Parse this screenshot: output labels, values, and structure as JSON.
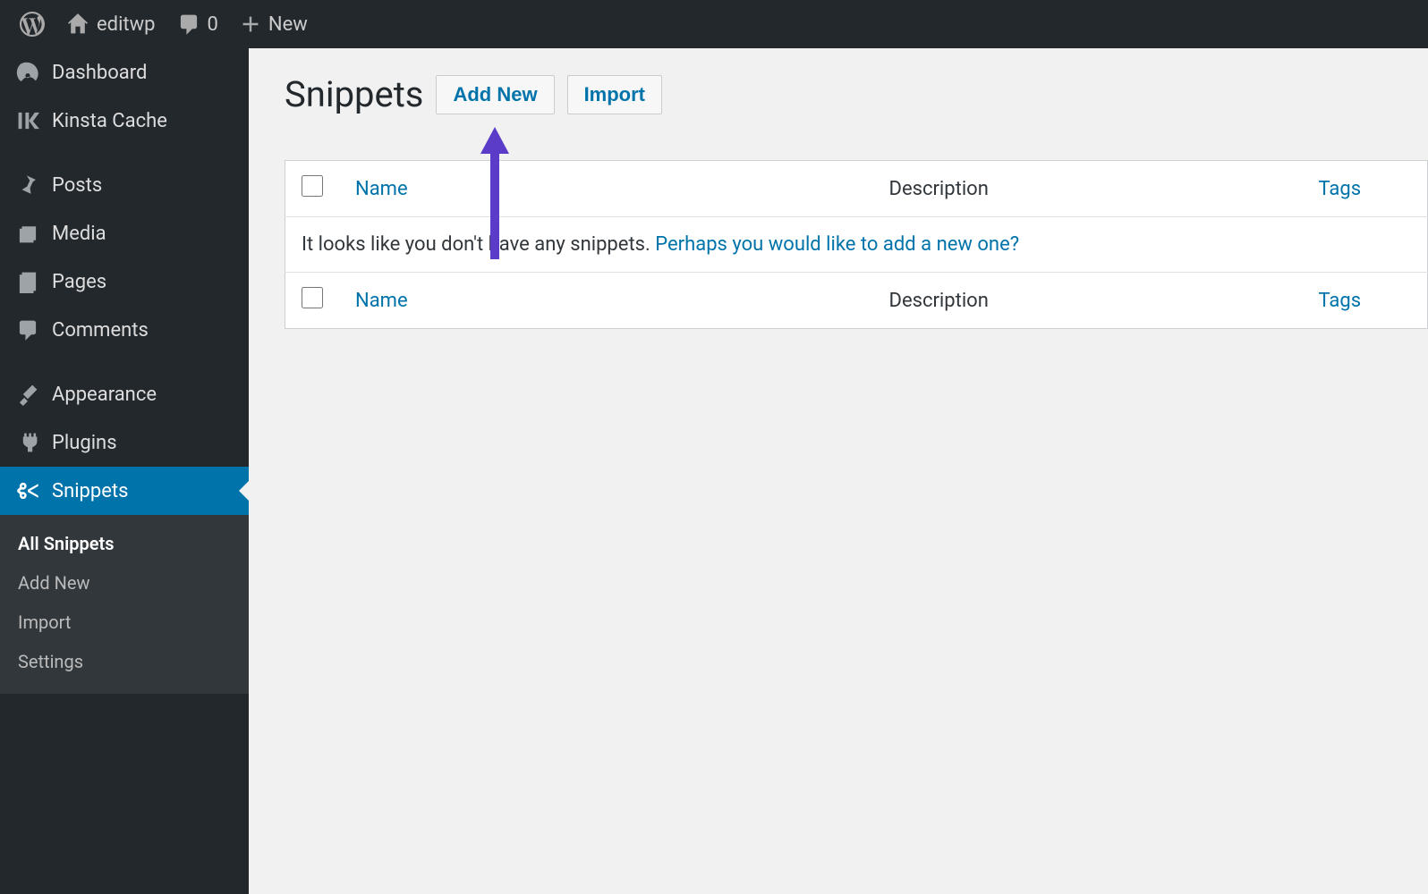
{
  "adminbar": {
    "site_name": "editwp",
    "comment_count": "0",
    "new_label": "New"
  },
  "sidebar": {
    "items": [
      {
        "label": "Dashboard"
      },
      {
        "label": "Kinsta Cache"
      },
      {
        "label": "Posts"
      },
      {
        "label": "Media"
      },
      {
        "label": "Pages"
      },
      {
        "label": "Comments"
      },
      {
        "label": "Appearance"
      },
      {
        "label": "Plugins"
      },
      {
        "label": "Snippets"
      }
    ],
    "submenu": [
      {
        "label": "All Snippets"
      },
      {
        "label": "Add New"
      },
      {
        "label": "Import"
      },
      {
        "label": "Settings"
      }
    ]
  },
  "page": {
    "title": "Snippets",
    "add_new_label": "Add New",
    "import_label": "Import"
  },
  "table": {
    "columns": {
      "name": "Name",
      "description": "Description",
      "tags": "Tags"
    },
    "empty_text": "It looks like you don't have any snippets. ",
    "empty_link": "Perhaps you would like to add a new one?"
  }
}
